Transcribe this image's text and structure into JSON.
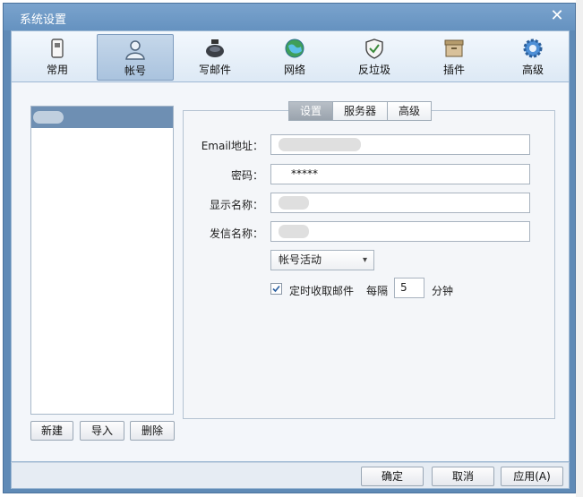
{
  "window": {
    "title": "系统设置"
  },
  "toolbar": {
    "items": [
      {
        "label": "常用",
        "icon": "phone-icon"
      },
      {
        "label": "帐号",
        "icon": "user-icon",
        "active": true
      },
      {
        "label": "写邮件",
        "icon": "ink-bottle-icon"
      },
      {
        "label": "网络",
        "icon": "globe-icon"
      },
      {
        "label": "反垃圾",
        "icon": "shield-icon"
      },
      {
        "label": "插件",
        "icon": "box-icon"
      },
      {
        "label": "高级",
        "icon": "gear-icon"
      }
    ]
  },
  "account_panel": {
    "buttons": {
      "new": "新建",
      "import": "导入",
      "delete": "删除"
    }
  },
  "tabs": [
    {
      "label": "设置",
      "active": true
    },
    {
      "label": "服务器"
    },
    {
      "label": "高级"
    }
  ],
  "form": {
    "email_label": "Email地址：",
    "password_label": "密码：",
    "password_value": "*****",
    "display_name_label": "显示名称：",
    "sender_name_label": "发信名称：",
    "status_select": "帐号活动",
    "auto_receive_label": "定时收取邮件",
    "auto_receive_checked": true,
    "interval_prefix": "每隔",
    "interval_value": "5",
    "interval_unit": "分钟"
  },
  "footer": {
    "ok": "确定",
    "cancel": "取消",
    "apply": "应用(A)"
  },
  "colors": {
    "accent": "#6e8fb3",
    "titlebar": "#6592c0"
  }
}
